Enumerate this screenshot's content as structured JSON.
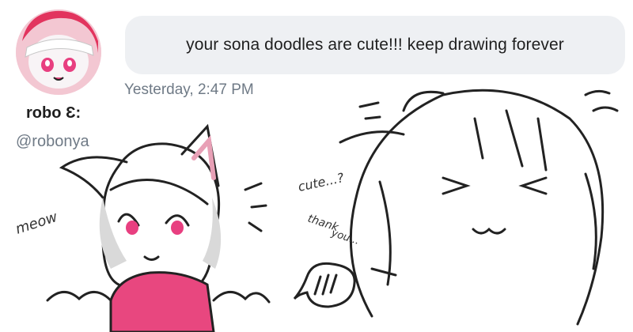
{
  "message": {
    "text": "your sona doodles are cute!!! keep drawing forever",
    "timestamp": "Yesterday, 2:47 PM"
  },
  "user": {
    "display_name": "robo Ɛ:",
    "handle": "@robonya",
    "avatar_icon": "avatar-image"
  },
  "drawing": {
    "left_caption": "meow",
    "right_caption_1": "cute...?",
    "right_caption_2": "thank",
    "right_caption_3": "you...",
    "accent_pink": "#e8477f",
    "line_color": "#222222"
  }
}
